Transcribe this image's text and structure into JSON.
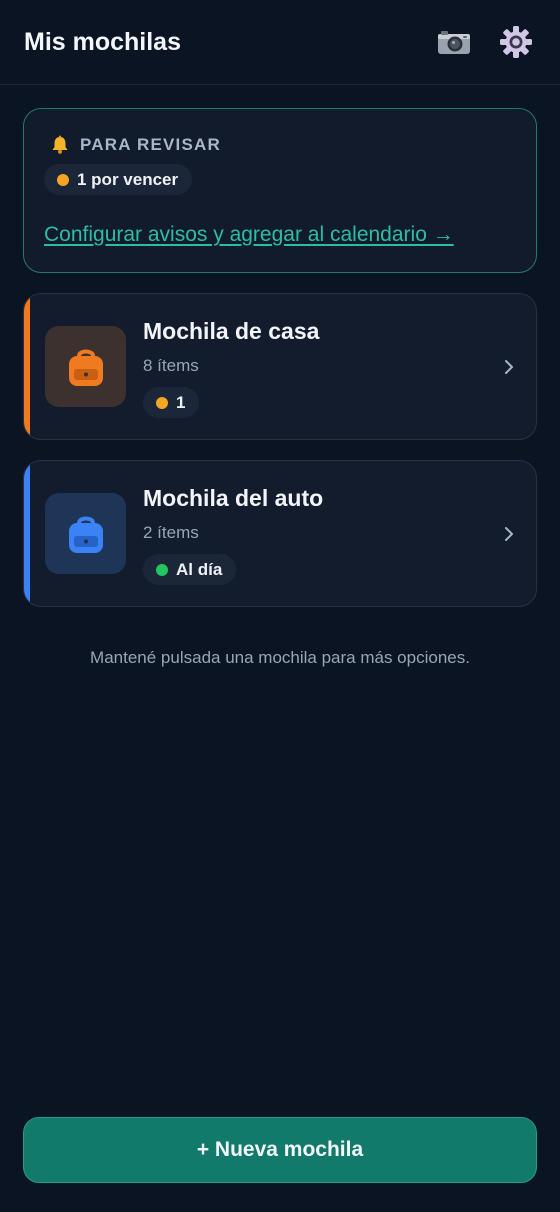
{
  "header": {
    "title": "Mis mochilas",
    "camera_icon": "camera-icon",
    "settings_icon": "gear-icon"
  },
  "review": {
    "icon": "bell-icon",
    "title": "PARA REVISAR",
    "pill_label": "1 por vencer",
    "pill_color": "#f5a524",
    "link": "Configurar avisos y agregar al calendario →"
  },
  "packs": [
    {
      "name": "Mochila de casa",
      "count": "8 ítems",
      "status": "1",
      "status_color": "#f5a524",
      "accent": "#f07a1f",
      "icon_bg": "#3d3130",
      "icon_color": "#f07a1f",
      "icon": "backpack-icon"
    },
    {
      "name": "Mochila del auto",
      "count": "2 ítems",
      "status": "Al día",
      "status_color": "#22c55e",
      "accent": "#3b82f6",
      "icon_bg": "#1f3558",
      "icon_color": "#3b82f6",
      "icon": "backpack-icon"
    }
  ],
  "hint": "Mantené pulsada una mochila para más opciones.",
  "new_button": "+ Nueva mochila"
}
